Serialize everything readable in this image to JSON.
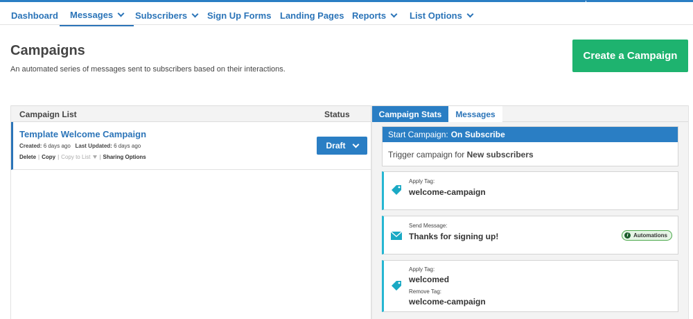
{
  "nav": {
    "dashboard": "Dashboard",
    "messages": "Messages",
    "subscribers": "Subscribers",
    "signup_forms": "Sign Up Forms",
    "landing_pages": "Landing Pages",
    "reports": "Reports",
    "list_options": "List Options",
    "active": "Messages"
  },
  "page": {
    "title": "Campaigns",
    "subtitle": "An automated series of messages sent to subscribers based on their interactions.",
    "create_button": "Create a Campaign"
  },
  "campaign_list": {
    "col_name": "Campaign List",
    "col_status": "Status",
    "rows": [
      {
        "title": "Template Welcome Campaign",
        "created_label": "Created:",
        "created_value": "6 days ago",
        "updated_label": "Last Updated:",
        "updated_value": "6 days ago",
        "actions": {
          "delete": "Delete",
          "copy": "Copy",
          "copy_to_list": "Copy to List",
          "sharing": "Sharing Options"
        },
        "status": "Draft"
      }
    ]
  },
  "stats": {
    "tabs": {
      "stats": "Campaign Stats",
      "messages": "Messages"
    },
    "start": {
      "label": "Start Campaign:",
      "trigger": "On Subscribe",
      "body_prefix": "Trigger campaign for",
      "body_value": "New subscribers"
    },
    "steps": [
      {
        "label": "Apply Tag:",
        "value": "welcome-campaign",
        "icon": "tag-icon"
      },
      {
        "label": "Send Message:",
        "value": "Thanks for signing up!",
        "icon": "envelope-icon",
        "badge": "Automations"
      },
      {
        "label": "Apply Tag:",
        "value": "welcomed",
        "label2": "Remove Tag:",
        "value2": "welcome-campaign",
        "icon": "tag-icon"
      }
    ]
  },
  "colors": {
    "primary": "#2a7ec4",
    "create_button": "#1eb36f",
    "step_accent": "#25b6d2",
    "tag_icon": "#1aa9c4",
    "badge_border": "#4aa84a"
  }
}
